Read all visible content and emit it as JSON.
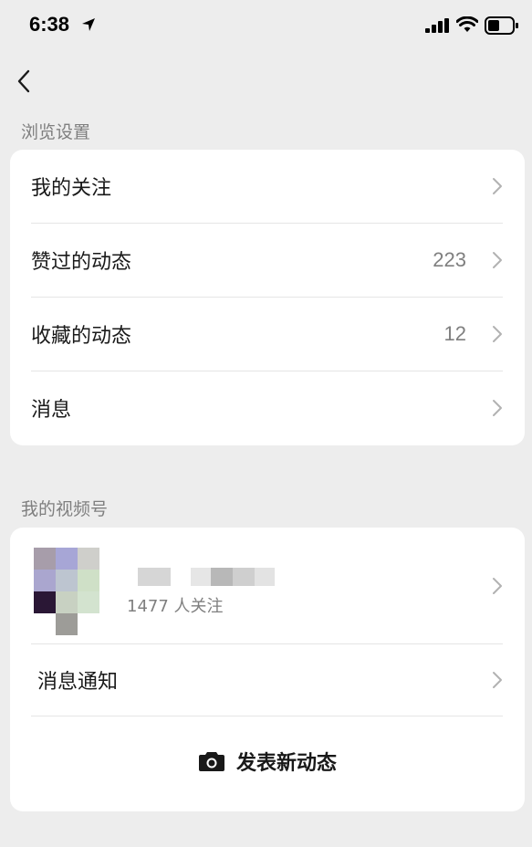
{
  "status_bar": {
    "time": "6:38"
  },
  "browse_settings": {
    "title": "浏览设置",
    "items": [
      {
        "label": "我的关注",
        "count": ""
      },
      {
        "label": "赞过的动态",
        "count": "223"
      },
      {
        "label": "收藏的动态",
        "count": "12"
      },
      {
        "label": "消息",
        "count": ""
      }
    ]
  },
  "channels": {
    "title": "我的视频号",
    "profile": {
      "followers": "1477 人关注"
    },
    "notify_label": "消息通知",
    "publish_label": "发表新动态"
  },
  "colors": {
    "background": "#ededed",
    "card": "#ffffff",
    "secondary_text": "#7f7f7f",
    "chevron": "#b2b2b2"
  }
}
